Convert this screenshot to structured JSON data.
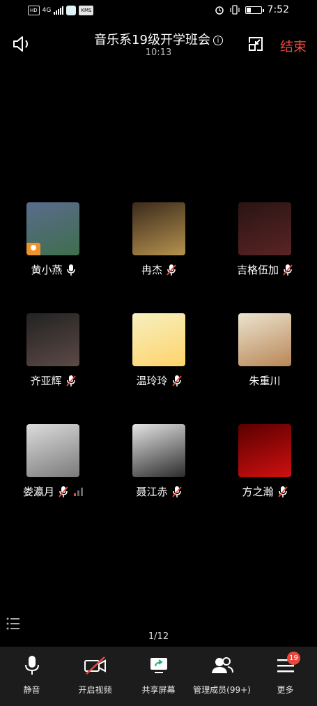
{
  "status_bar": {
    "chip_hd": "HD",
    "chip_net": "4G",
    "chip_msg": "KMS",
    "time": "7:52"
  },
  "header": {
    "title": "音乐系19级开学班会",
    "duration": "10:13",
    "end_label": "结束"
  },
  "participants": [
    {
      "name": "黄小燕",
      "mic": "on",
      "host": true,
      "colors": [
        "#5a6b8c",
        "#3f6e4d"
      ]
    },
    {
      "name": "冉杰",
      "mic": "muted",
      "colors": [
        "#3b2a1c",
        "#b5924e"
      ]
    },
    {
      "name": "吉格伍加",
      "mic": "muted",
      "colors": [
        "#2a1414",
        "#5a2424"
      ]
    },
    {
      "name": "齐亚辉",
      "mic": "muted",
      "colors": [
        "#222",
        "#5c4a46"
      ]
    },
    {
      "name": "温玲玲",
      "mic": "muted",
      "colors": [
        "#f6f0c0",
        "#ffd36a"
      ]
    },
    {
      "name": "朱重川",
      "mic": "none",
      "colors": [
        "#ece4cf",
        "#b88656"
      ]
    },
    {
      "name": "娄瀛月",
      "mic": "muted",
      "signal": true,
      "colors": [
        "#dcdcdc",
        "#7a7a7a"
      ]
    },
    {
      "name": "聂江赤",
      "mic": "muted",
      "colors": [
        "#e4e4e4",
        "#2b2b2b"
      ]
    },
    {
      "name": "方之瀚",
      "mic": "muted",
      "colors": [
        "#5a0000",
        "#d01010"
      ]
    }
  ],
  "pager": "1/12",
  "toolbar": {
    "mute": "静音",
    "video": "开启视频",
    "share": "共享屏幕",
    "members": "管理成员(99+)",
    "more": "更多",
    "more_badge": "19"
  }
}
